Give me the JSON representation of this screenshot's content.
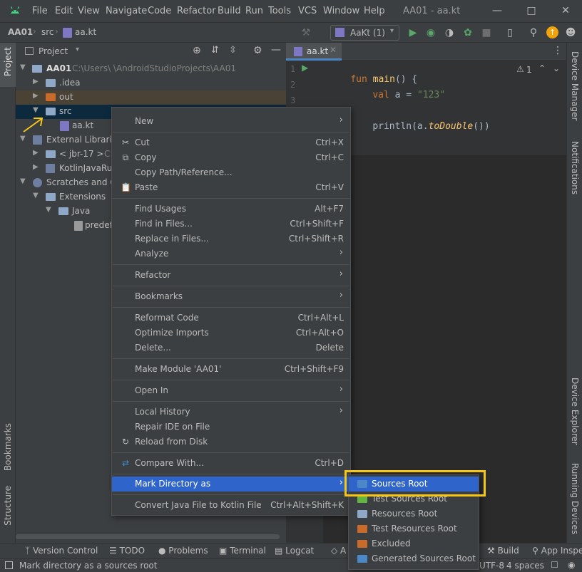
{
  "colors": {
    "accent_selection": "#2f65ca",
    "highlight_annotation": "#f5c518",
    "background_panel": "#3c3f41",
    "background_editor": "#2b2b2b",
    "folder_blue": "#8fa8c8",
    "folder_orange": "#c86b2a",
    "sources_root_blue": "#4a88c7",
    "test_green": "#62b543"
  },
  "menubar": {
    "items": [
      "File",
      "Edit",
      "View",
      "Navigate",
      "Code",
      "Refactor",
      "Build",
      "Run",
      "Tools",
      "VCS",
      "Window",
      "Help"
    ],
    "window_title": "AA01 - aa.kt"
  },
  "navbar": {
    "breadcrumbs": [
      "AA01",
      "src",
      "aa.kt"
    ],
    "run_config": "AaKt (1)"
  },
  "left_strip": {
    "top": "Project",
    "bottom1": "Bookmarks",
    "bottom2": "Structure"
  },
  "right_strip": {
    "top1": "Device Manager",
    "top2": "Notifications",
    "bottom1": "Device Explorer",
    "bottom2": "Running Devices"
  },
  "project_panel": {
    "title": "Project",
    "tree": [
      {
        "label": "AA01",
        "hint": "C:\\Users\\        \\AndroidStudioProjects\\AA01"
      },
      {
        "label": ".idea"
      },
      {
        "label": "out"
      },
      {
        "label": "src"
      },
      {
        "label": "aa.kt"
      },
      {
        "label": "External Libraries"
      },
      {
        "label": "< jbr-17 >",
        "hint": "C:"
      },
      {
        "label": "KotlinJavaRun"
      },
      {
        "label": "Scratches and Co"
      },
      {
        "label": "Extensions"
      },
      {
        "label": "Java"
      },
      {
        "label": "predefi"
      }
    ]
  },
  "editor": {
    "tab": "aa.kt",
    "warning_count": "1",
    "line_numbers": [
      "1",
      "2",
      "3"
    ],
    "code": {
      "kw_fun": "fun",
      "fn_main": "main",
      "paren_open": "() {",
      "kw_val": "val",
      "var_assign": " a = ",
      "str_val": "\"123\"",
      "println_pre": "println(a.",
      "println_fn": "toDouble",
      "println_post": "())"
    }
  },
  "context_menu": {
    "items": [
      {
        "label": "New",
        "shortcut": "",
        "submenu": true
      },
      {
        "label": "Cut",
        "shortcut": "Ctrl+X",
        "icon": "scissors-icon"
      },
      {
        "label": "Copy",
        "shortcut": "Ctrl+C",
        "icon": "copy-icon"
      },
      {
        "label": "Copy Path/Reference...",
        "shortcut": ""
      },
      {
        "label": "Paste",
        "shortcut": "Ctrl+V",
        "icon": "paste-icon"
      },
      {
        "label": "Find Usages",
        "shortcut": "Alt+F7"
      },
      {
        "label": "Find in Files...",
        "shortcut": "Ctrl+Shift+F"
      },
      {
        "label": "Replace in Files...",
        "shortcut": "Ctrl+Shift+R"
      },
      {
        "label": "Analyze",
        "shortcut": "",
        "submenu": true
      },
      {
        "label": "Refactor",
        "shortcut": "",
        "submenu": true
      },
      {
        "label": "Bookmarks",
        "shortcut": "",
        "submenu": true
      },
      {
        "label": "Reformat Code",
        "shortcut": "Ctrl+Alt+L"
      },
      {
        "label": "Optimize Imports",
        "shortcut": "Ctrl+Alt+O"
      },
      {
        "label": "Delete...",
        "shortcut": "Delete"
      },
      {
        "label": "Make Module 'AA01'",
        "shortcut": "Ctrl+Shift+F9"
      },
      {
        "label": "Open In",
        "shortcut": "",
        "submenu": true
      },
      {
        "label": "Local History",
        "shortcut": "",
        "submenu": true
      },
      {
        "label": "Repair IDE on File",
        "shortcut": ""
      },
      {
        "label": "Reload from Disk",
        "shortcut": "",
        "icon": "reload-icon"
      },
      {
        "label": "Compare With...",
        "shortcut": "Ctrl+D",
        "icon": "compare-icon"
      },
      {
        "label": "Mark Directory as",
        "shortcut": "",
        "submenu": true,
        "selected": true
      },
      {
        "label": "Convert Java File to Kotlin File",
        "shortcut": "Ctrl+Alt+Shift+K"
      }
    ]
  },
  "submenu": {
    "items": [
      {
        "label": "Sources Root",
        "selected": true
      },
      {
        "label": "Test Sources Root"
      },
      {
        "label": "Resources Root"
      },
      {
        "label": "Test Resources Root"
      },
      {
        "label": "Excluded"
      },
      {
        "label": "Generated Sources Root"
      }
    ]
  },
  "bottom_tools": [
    "Version Control",
    "TODO",
    "Problems",
    "Terminal",
    "Logcat",
    "A",
    "Build",
    "App Inspe"
  ],
  "statusbar": {
    "message": "Mark directory as a sources root",
    "encoding": "UTF-8",
    "indent": "4 spaces"
  }
}
